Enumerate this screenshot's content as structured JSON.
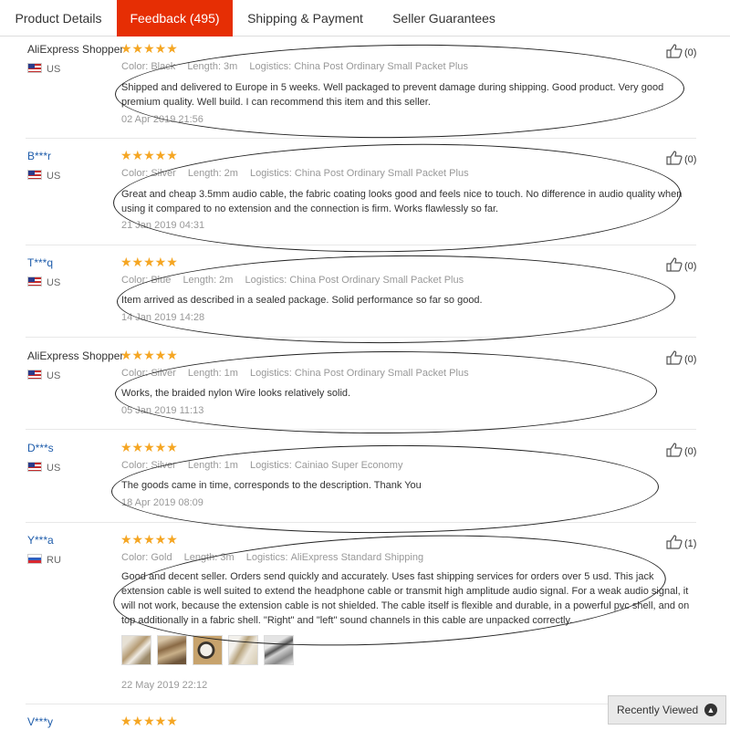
{
  "tabs": [
    {
      "label": "Product Details"
    },
    {
      "label": "Feedback (495)"
    },
    {
      "label": "Shipping & Payment"
    },
    {
      "label": "Seller Guarantees"
    }
  ],
  "meta_labels": {
    "color": "Color:",
    "length": "Length:",
    "logistics": "Logistics:"
  },
  "reviews": [
    {
      "user": "AliExpress Shopper",
      "country": "US",
      "stars": "★★★★★",
      "color": "Black",
      "length": "3m",
      "logistics": "China Post Ordinary Small Packet Plus",
      "text": "Shipped and delivered to Europe in 5 weeks. Well packaged to prevent damage during shipping. Good product. Very good premium quality. Well build. I can recommend this item and this seller.",
      "date": "02 Apr 2019 21:56",
      "helpful": "(0)"
    },
    {
      "user": "B***r",
      "country": "US",
      "stars": "★★★★★",
      "color": "Silver",
      "length": "2m",
      "logistics": "China Post Ordinary Small Packet Plus",
      "text": "Great and cheap 3.5mm audio cable, the fabric coating looks good and feels nice to touch. No difference in audio quality when using it compared to no extension and the connection is firm. Works flawlessly so far.",
      "date": "21 Jan 2019 04:31",
      "helpful": "(0)"
    },
    {
      "user": "T***q",
      "country": "US",
      "stars": "★★★★★",
      "color": "Blue",
      "length": "2m",
      "logistics": "China Post Ordinary Small Packet Plus",
      "text": "Item arrived as described in a sealed package. Solid performance so far so good.",
      "date": "14 Jan 2019 14:28",
      "helpful": "(0)"
    },
    {
      "user": "AliExpress Shopper",
      "country": "US",
      "stars": "★★★★★",
      "color": "Silver",
      "length": "1m",
      "logistics": "China Post Ordinary Small Packet Plus",
      "text": "Works, the braided nylon Wire looks relatively solid.",
      "date": "05 Jan 2019 11:13",
      "helpful": "(0)"
    },
    {
      "user": "D***s",
      "country": "US",
      "stars": "★★★★★",
      "color": "Silver",
      "length": "1m",
      "logistics": "Cainiao Super Economy",
      "text": "The goods came in time, corresponds to the description. Thank You",
      "date": "18 Apr 2019 08:09",
      "helpful": "(0)"
    },
    {
      "user": "Y***a",
      "country": "RU",
      "stars": "★★★★★",
      "color": "Gold",
      "length": "3m",
      "logistics": "AliExpress Standard Shipping",
      "text": "Good and decent seller. Orders send quickly and accurately. Uses fast shipping services for orders over 5 usd. This jack extension cable is well suited to extend the headphone cable or transmit high amplitude audio signal. For a weak audio signal, it will not work, because the extension cable is not shielded. The cable itself is flexible and durable, in a powerful pvc shell, and on top additionally in a fabric shell. \"Right\" and \"left\" sound channels in this cable are unpacked correctly.",
      "date": "22 May 2019 22:12",
      "helpful": "(1)"
    },
    {
      "user": "V***y",
      "stars": "★★★★★"
    }
  ],
  "recently_viewed": {
    "label": "Recently Viewed",
    "icon": "chevron-up-icon"
  },
  "colors": {
    "accent": "#e62e04",
    "star": "#f5a623",
    "link": "#1f5dab"
  }
}
